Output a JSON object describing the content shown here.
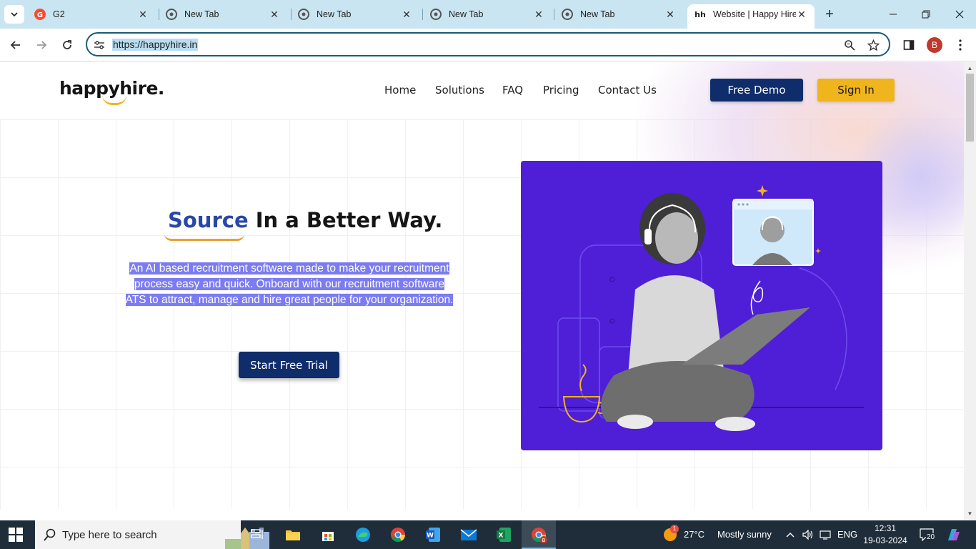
{
  "browser": {
    "tabs": [
      {
        "title": "G2",
        "active": false
      },
      {
        "title": "New Tab",
        "active": false
      },
      {
        "title": "New Tab",
        "active": false
      },
      {
        "title": "New Tab",
        "active": false
      },
      {
        "title": "New Tab",
        "active": false
      },
      {
        "title": "Website | Happy Hire",
        "active": true,
        "favicon_text": "hh"
      }
    ],
    "url": "https://happyhire.in",
    "profile_initial": "B"
  },
  "site": {
    "logo": "happyhire.",
    "nav": [
      "Home",
      "Solutions",
      "FAQ",
      "Pricing",
      "Contact Us"
    ],
    "demo_button": "Free Demo",
    "signin_button": "Sign In",
    "headline_accent": "Source",
    "headline_rest": " In a Better Way.",
    "description": "An AI based recruitment software made to make your recruitment process easy and quick. Onboard with our recruitment software ATS to attract, manage and hire great people for your organization.",
    "trial_button": "Start Free Trial",
    "colors": {
      "primary": "#0f2d6b",
      "accent": "#f0b41c",
      "hero_bg": "#4e1fd6"
    }
  },
  "taskbar": {
    "search_placeholder": "Type here to search",
    "weather_temp": "27°C",
    "weather_text": "Mostly sunny",
    "weather_badge": "1",
    "language": "ENG",
    "time": "12:31",
    "date": "19-03-2024",
    "notification_count": "20"
  }
}
